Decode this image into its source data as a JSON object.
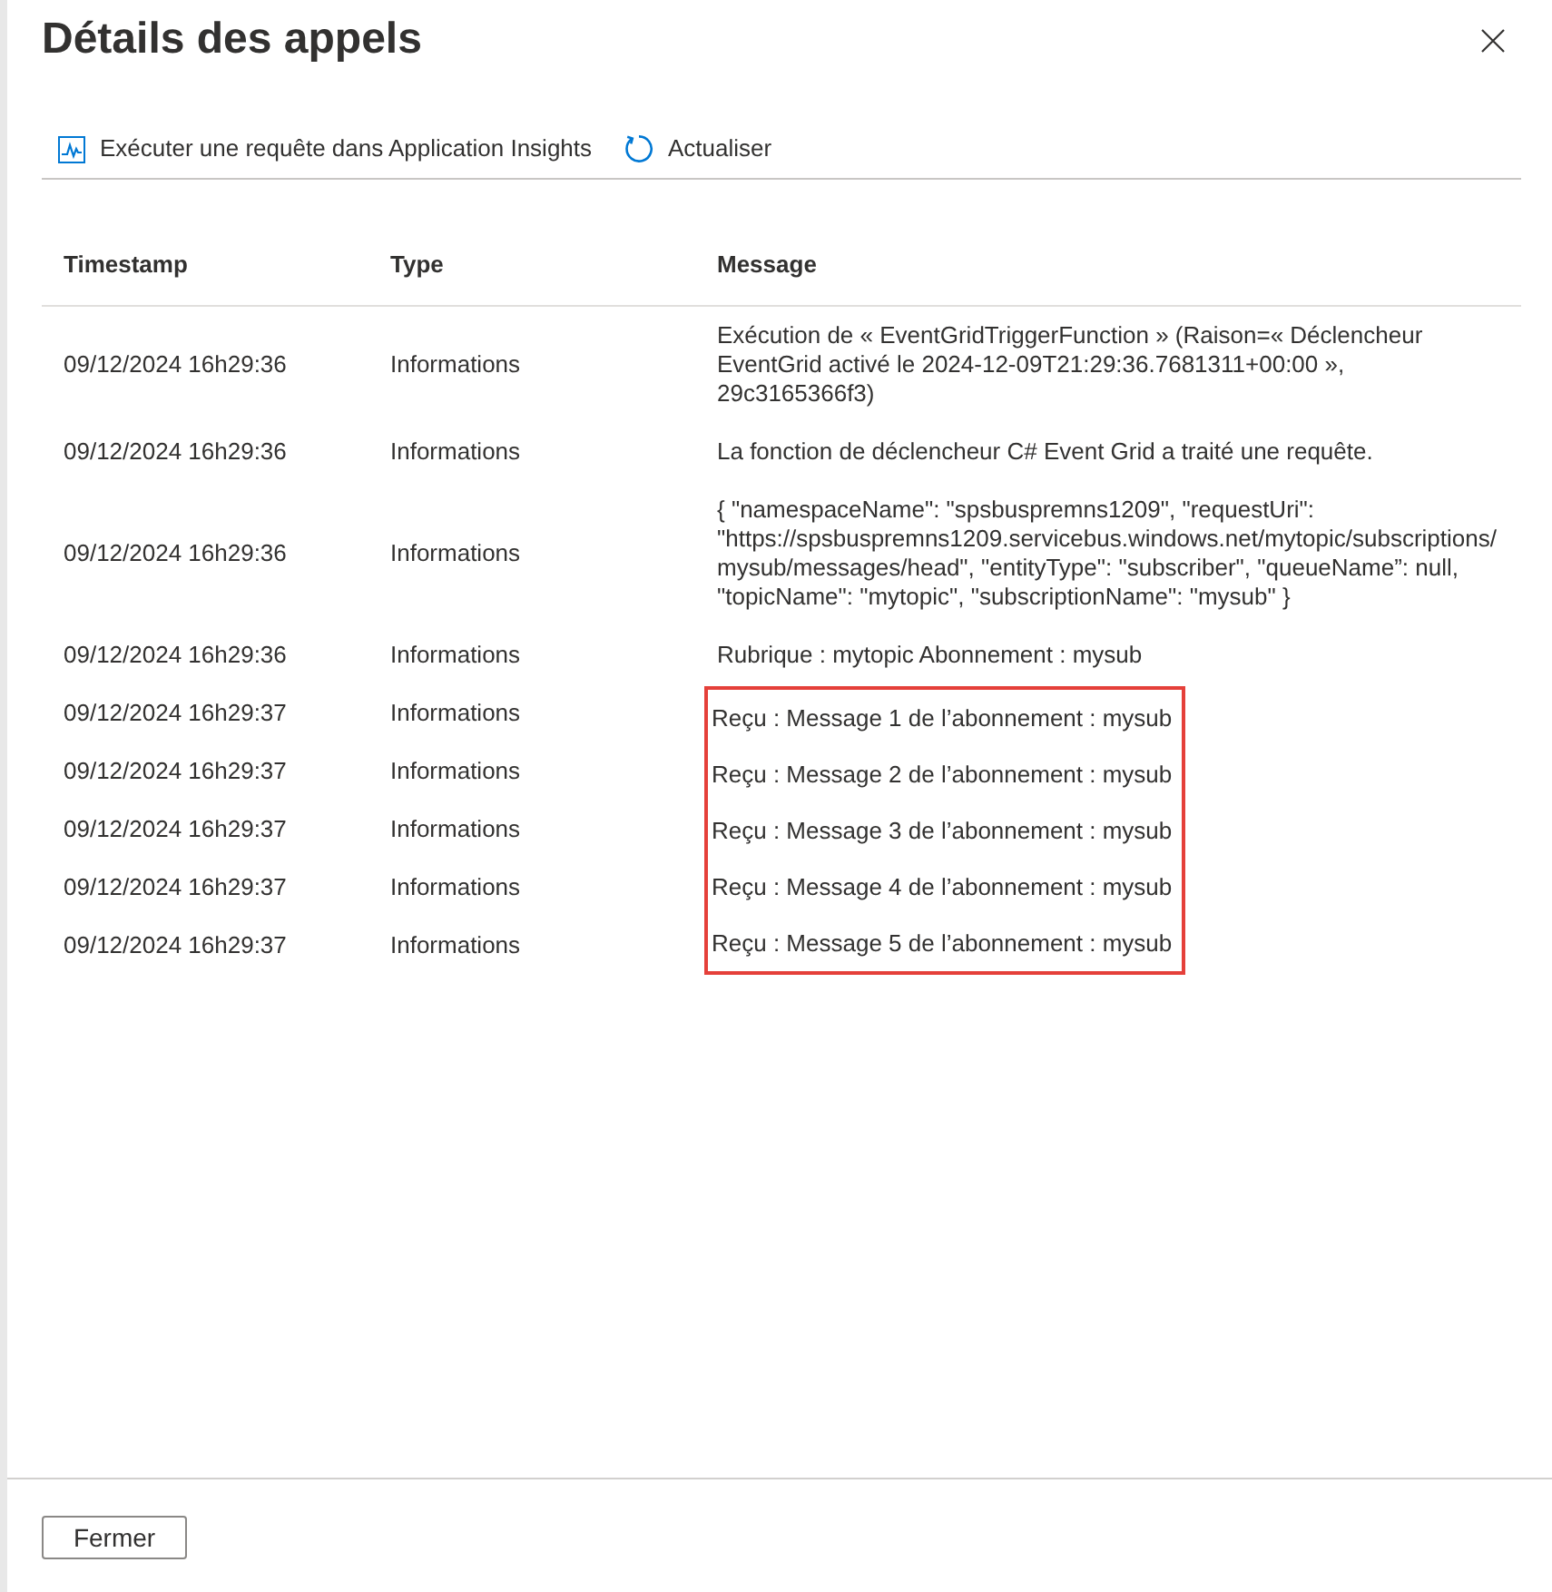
{
  "panel": {
    "title": "Détails des appels"
  },
  "toolbar": [
    {
      "kind": "query",
      "label": "Exécuter une requête dans Application Insights"
    },
    {
      "kind": "refresh",
      "label": "Actualiser"
    }
  ],
  "table": {
    "columns": [
      "Timestamp",
      "Type",
      "Message"
    ],
    "rows": [
      {
        "timestamp": "09/12/2024 16h29:36",
        "type": "Informations",
        "message": [
          "Exécution de « EventGridTriggerFunction » (Raison=« Déclencheur",
          "EventGrid activé le 2024-12-09T21:29:36.7681311+00:00 »,",
          "29c3165366f3)"
        ],
        "highlighted": false
      },
      {
        "timestamp": "09/12/2024 16h29:36",
        "type": "Informations",
        "message": [
          "La fonction de déclencheur C# Event Grid a traité une requête."
        ],
        "highlighted": false
      },
      {
        "timestamp": "09/12/2024 16h29:36",
        "type": "Informations",
        "message": [
          "{ \"namespaceName\": \"spsbuspremns1209\", \"requestUri\":",
          "\"https://spsbuspremns1209.servicebus.windows.net/mytopic/subscriptions/",
          "mysub/messages/head\", \"entityType\": \"subscriber\", \"queueName”: null,",
          "\"topicName\": \"mytopic\", \"subscriptionName\": \"mysub\" }"
        ],
        "highlighted": false
      },
      {
        "timestamp": "09/12/2024 16h29:36",
        "type": "Informations",
        "message": [
          "Rubrique : mytopic Abonnement : mysub"
        ],
        "highlighted": false
      },
      {
        "timestamp": "09/12/2024 16h29:37",
        "type": "Informations",
        "message": [
          "Reçu : Message 1 de l’abonnement : mysub"
        ],
        "highlighted": true
      },
      {
        "timestamp": "09/12/2024 16h29:37",
        "type": "Informations",
        "message": [
          "Reçu : Message 2 de l’abonnement : mysub"
        ],
        "highlighted": true
      },
      {
        "timestamp": "09/12/2024 16h29:37",
        "type": "Informations",
        "message": [
          "Reçu : Message 3 de l’abonnement : mysub"
        ],
        "highlighted": true
      },
      {
        "timestamp": "09/12/2024 16h29:37",
        "type": "Informations",
        "message": [
          "Reçu : Message 4 de l’abonnement : mysub"
        ],
        "highlighted": true
      },
      {
        "timestamp": "09/12/2024 16h29:37",
        "type": "Informations",
        "message": [
          "Reçu : Message 5 de l’abonnement : mysub"
        ],
        "highlighted": true
      }
    ]
  },
  "footer": {
    "buttons": [
      "Fermer"
    ]
  }
}
